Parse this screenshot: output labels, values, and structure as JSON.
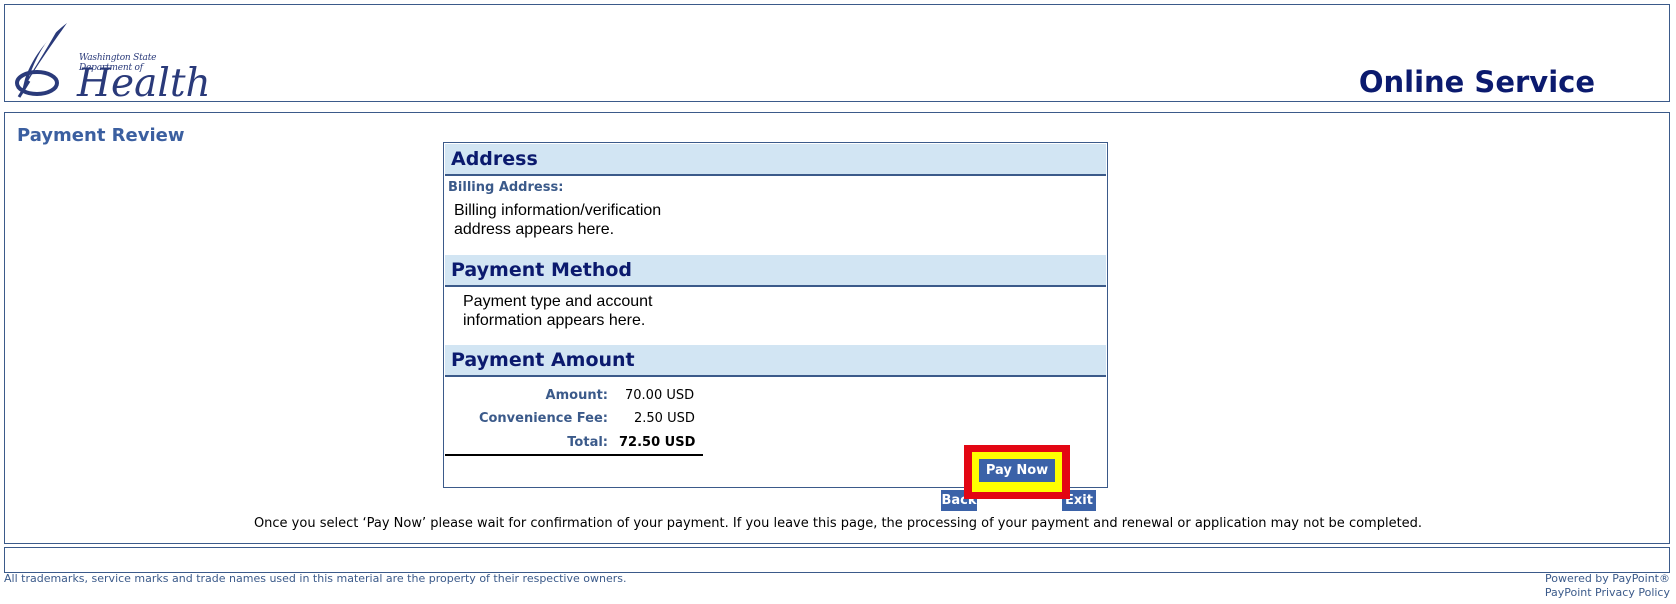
{
  "header": {
    "logo_dept": "Washington State Department of",
    "logo_name": "Health",
    "site_title": "Online Service"
  },
  "page": {
    "heading": "Payment Review"
  },
  "address": {
    "section_title": "Address",
    "billing_label": "Billing Address:",
    "billing_text_line1": "Billing information/verification",
    "billing_text_line2": "address appears here."
  },
  "payment_method": {
    "section_title": "Payment Method",
    "text_line1": "Payment type and account",
    "text_line2": "information appears here."
  },
  "payment_amount": {
    "section_title": "Payment Amount",
    "amount_label": "Amount:",
    "amount_value": "70.00 USD",
    "fee_label": "Convenience Fee:",
    "fee_value": "2.50 USD",
    "total_label": "Total:",
    "total_value": "72.50 USD"
  },
  "buttons": {
    "back": "Back",
    "pay_now": "Pay Now",
    "exit": "Exit"
  },
  "notice": "Once you select ‘Pay Now’ please wait for confirmation of your payment. If you leave this page, the processing of your payment and renewal or application may not be completed.",
  "footer": {
    "trademark": "All trademarks, service marks and trade names used in this material are the property of their respective owners.",
    "powered_by": "Powered by PayPoint®",
    "privacy_link": "PayPoint Privacy Policy"
  },
  "colors": {
    "navy": "#0b1a6e",
    "accent_blue": "#3b62a8",
    "section_bg": "#d2e5f3",
    "highlight_red": "#e30613",
    "highlight_yellow": "#ffff00"
  }
}
